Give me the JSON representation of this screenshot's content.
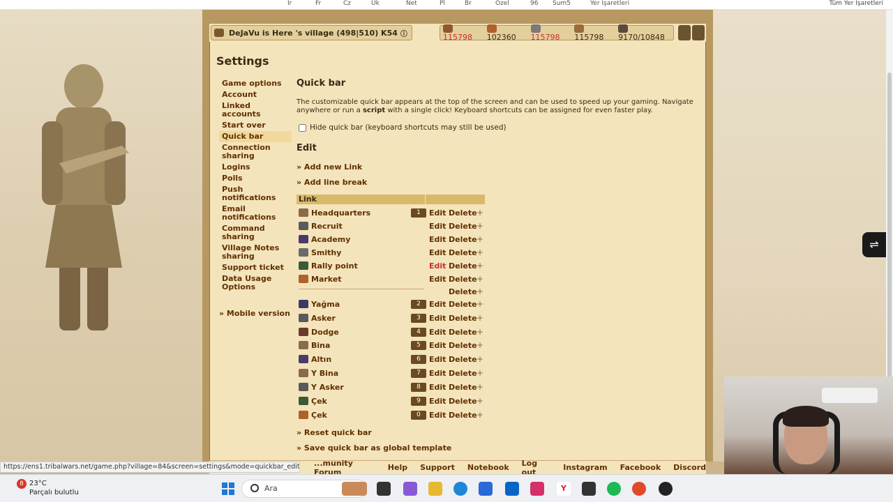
{
  "browser": {
    "bookmarks": [
      "Ir",
      "Fr",
      "Cz",
      "Uk",
      "Net",
      "Pl",
      "Br",
      "Özel",
      "96",
      "Sum5",
      "Yer İşaretleri"
    ],
    "bookmarks_right": "Tüm Yer İşaretleri",
    "status_url": "https://ens1.tribalwars.net/game.php?village=84&screen=settings&mode=quickbar_edit&ha..."
  },
  "header": {
    "village": "DeJaVu is Here 's village (498|510) K54",
    "resources": [
      {
        "icon": "wood-icon",
        "value": "115798",
        "warn": true
      },
      {
        "icon": "clay-icon",
        "value": "102360",
        "warn": false
      },
      {
        "icon": "iron-icon",
        "value": "115798",
        "warn": true
      },
      {
        "icon": "storage-icon",
        "value": "115798",
        "warn": false
      },
      {
        "icon": "population-icon",
        "value": "9170/10848",
        "warn": false
      }
    ]
  },
  "page": {
    "title": "Settings"
  },
  "menu": {
    "items": [
      "Game options",
      "Account",
      "Linked accounts",
      "Start over",
      "Quick bar",
      "Connection sharing",
      "Logins",
      "Polls",
      "Push notifications",
      "Email notifications",
      "Command sharing",
      "Village Notes sharing",
      "Support ticket",
      "Data Usage Options"
    ],
    "selected": "Quick bar",
    "mobile": "» Mobile version"
  },
  "quickbar": {
    "heading": "Quick bar",
    "desc_part1": "The customizable quick bar appears at the top of the screen and can be used to speed up your gaming. Navigate anywhere or run a ",
    "desc_bold": "script",
    "desc_part2": " with a single click! Keyboard shortcuts can be assigned for even faster play.",
    "hide_label": "Hide quick bar (keyboard shortcuts may still be used)",
    "edit_heading": "Edit",
    "add_link": "» Add new Link",
    "add_break": "» Add line break",
    "col_link": "Link",
    "edit_label": "Edit",
    "delete_label": "Delete",
    "move_label": "+",
    "reset": "» Reset quick bar",
    "save_global": "» Save quick bar as global template"
  },
  "links": [
    {
      "name": "Headquarters",
      "key": "1",
      "icon": "headquarters-icon",
      "color": "#8a6a4a"
    },
    {
      "name": "Recruit",
      "key": "",
      "icon": "recruit-icon",
      "color": "#5a5a5a"
    },
    {
      "name": "Academy",
      "key": "",
      "icon": "academy-icon",
      "color": "#4a3a6a"
    },
    {
      "name": "Smithy",
      "key": "",
      "icon": "smithy-icon",
      "color": "#6a6a6a"
    },
    {
      "name": "Rally point",
      "key": "",
      "icon": "rally-point-icon",
      "color": "#3a5a3a"
    },
    {
      "name": "Market",
      "key": "",
      "icon": "market-icon",
      "color": "#b0602a"
    },
    {
      "name": "",
      "key": "",
      "icon": "",
      "color": ""
    },
    {
      "name": "Yağma",
      "key": "2",
      "icon": "yagma-icon",
      "color": "#3a3a6a"
    },
    {
      "name": "Asker",
      "key": "3",
      "icon": "asker-icon",
      "color": "#5a5a5a"
    },
    {
      "name": "Dodge",
      "key": "4",
      "icon": "dodge-icon",
      "color": "#6a3a2a"
    },
    {
      "name": "Bina",
      "key": "5",
      "icon": "bina-icon",
      "color": "#8a6a4a"
    },
    {
      "name": "Altın",
      "key": "6",
      "icon": "altin-icon",
      "color": "#4a3a6a"
    },
    {
      "name": "Y Bina",
      "key": "7",
      "icon": "y-bina-icon",
      "color": "#8a6a4a"
    },
    {
      "name": "Y Asker",
      "key": "8",
      "icon": "y-asker-icon",
      "color": "#5a5a5a"
    },
    {
      "name": "Çek",
      "key": "9",
      "icon": "cek-icon",
      "color": "#3a5a3a"
    },
    {
      "name": "Çek",
      "key": "0",
      "icon": "cek-icon",
      "color": "#b0602a"
    }
  ],
  "footer": {
    "links": [
      "...munity Forum",
      "Help",
      "Support",
      "Notebook",
      "Log out",
      "Instagram",
      "Facebook",
      "Discord"
    ]
  },
  "taskbar": {
    "temp": "23°C",
    "weather": "Parçalı bulutlu",
    "badge": "8",
    "search_placeholder": "Ara"
  }
}
